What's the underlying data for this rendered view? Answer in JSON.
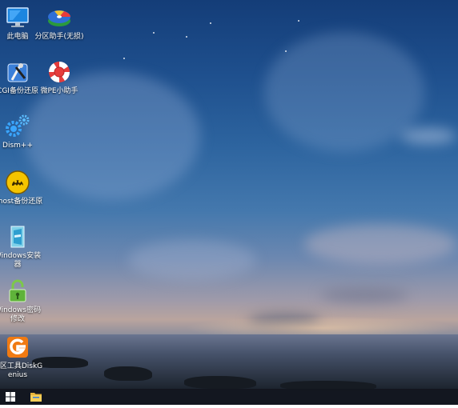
{
  "desktop_icons": [
    {
      "name": "this-pc",
      "label": "此电脑",
      "icon": "computer-icon"
    },
    {
      "name": "partition-assistant",
      "label": "分区助手(无损)",
      "icon": "partition-disk-icon"
    },
    {
      "name": "cgi-backup",
      "label": "CGI备份还原",
      "icon": "cgi-tools-icon"
    },
    {
      "name": "pe-helper",
      "label": "微PE小助手",
      "icon": "lifebuoy-icon"
    },
    {
      "name": "dism",
      "label": "Dism++",
      "icon": "gears-icon"
    },
    {
      "name": "ghost",
      "label": "Ghost备份还原",
      "icon": "ghost-icon"
    },
    {
      "name": "windows-installer",
      "label": "Windows安装器",
      "icon": "installer-icon"
    },
    {
      "name": "windows-password",
      "label": "Windows密码修改",
      "icon": "padlock-icon"
    },
    {
      "name": "diskgenius",
      "label": "分区工具DiskGenius",
      "icon": "diskgenius-icon"
    }
  ],
  "taskbar": {
    "start_icon": "windows-start-icon",
    "explorer_icon": "folder-icon"
  },
  "colors": {
    "sky_top": "#143d78",
    "horizon": "#b9a49e",
    "taskbar": "#12161e"
  }
}
